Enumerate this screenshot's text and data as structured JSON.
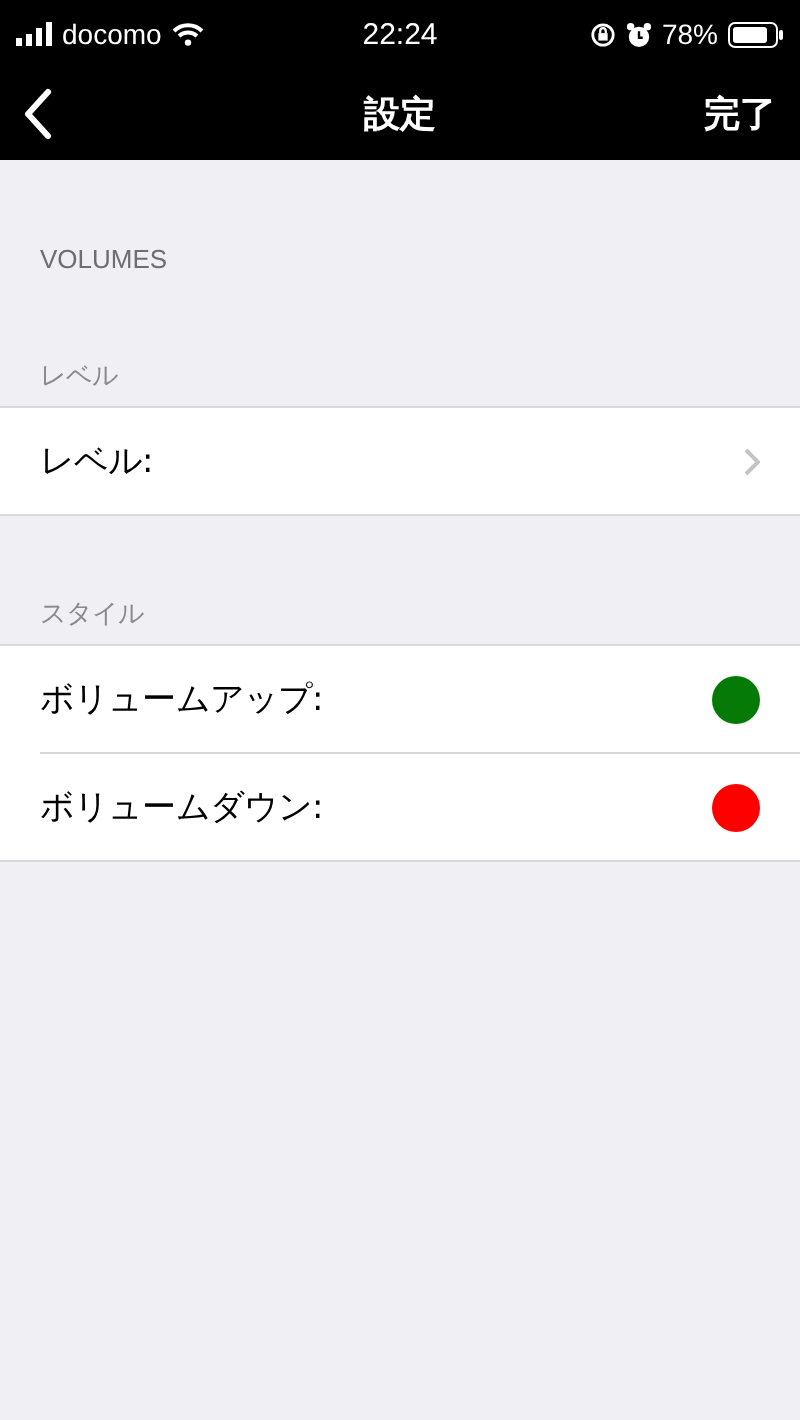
{
  "status_bar": {
    "carrier": "docomo",
    "time": "22:24",
    "battery": "78%"
  },
  "nav_bar": {
    "title": "設定",
    "done": "完了"
  },
  "page_heading": "VOLUMES",
  "sections": [
    {
      "header": "レベル",
      "rows": [
        {
          "kind": "disclosure",
          "label": "レベル:"
        }
      ]
    },
    {
      "header": "スタイル",
      "rows": [
        {
          "kind": "color",
          "label": "ボリュームアップ:",
          "color": "#067a06"
        },
        {
          "kind": "color",
          "label": "ボリュームダウン:",
          "color": "#ff0000"
        }
      ]
    }
  ]
}
